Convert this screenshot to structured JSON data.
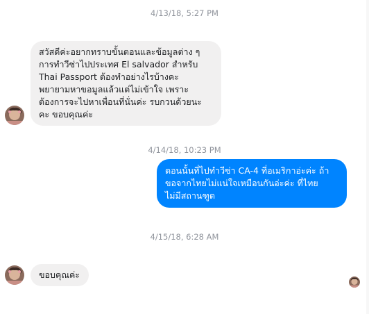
{
  "conversation": {
    "timestamps": [
      "4/13/18, 5:27 PM",
      "4/14/18, 10:23 PM",
      "4/15/18, 6:28 AM"
    ],
    "messages": [
      {
        "direction": "incoming",
        "lines": [
          "สวัสดีค่ะอยากทราบขั้นตอนและข้อมูลต่าง ๆ",
          "การทำวีซ่าไปประเทศ El salvador สำหรับ",
          "Thai Passport ต้องทำอย่างไรบ้างคะ",
          "พยายามหาขอมูลแล้วแต่ไม่เข้าใจ   เพราะ",
          "ต้องการจะไปหาเพื่อนที่นั่นค่ะ  รบกวนด้วยนะ",
          "คะ  ขอบคุณค่ะ"
        ]
      },
      {
        "direction": "outgoing",
        "lines": [
          "ตอนนั้นที่ไปทำวีซ่า CA-4 ที่อเมริกาอ่ะค่ะ ถ้า",
          "ขอจากไทยไม่แน่ใจเหมือนกันอ่ะค่ะ ที่ไทย",
          "ไม่มีสถานฑูต"
        ]
      },
      {
        "direction": "incoming",
        "lines": [
          "ขอบคุณค่ะ"
        ]
      }
    ]
  },
  "colors": {
    "incoming_bubble": "#f1f0f0",
    "outgoing_bubble": "#0084ff",
    "timestamp_text": "#90949c"
  }
}
